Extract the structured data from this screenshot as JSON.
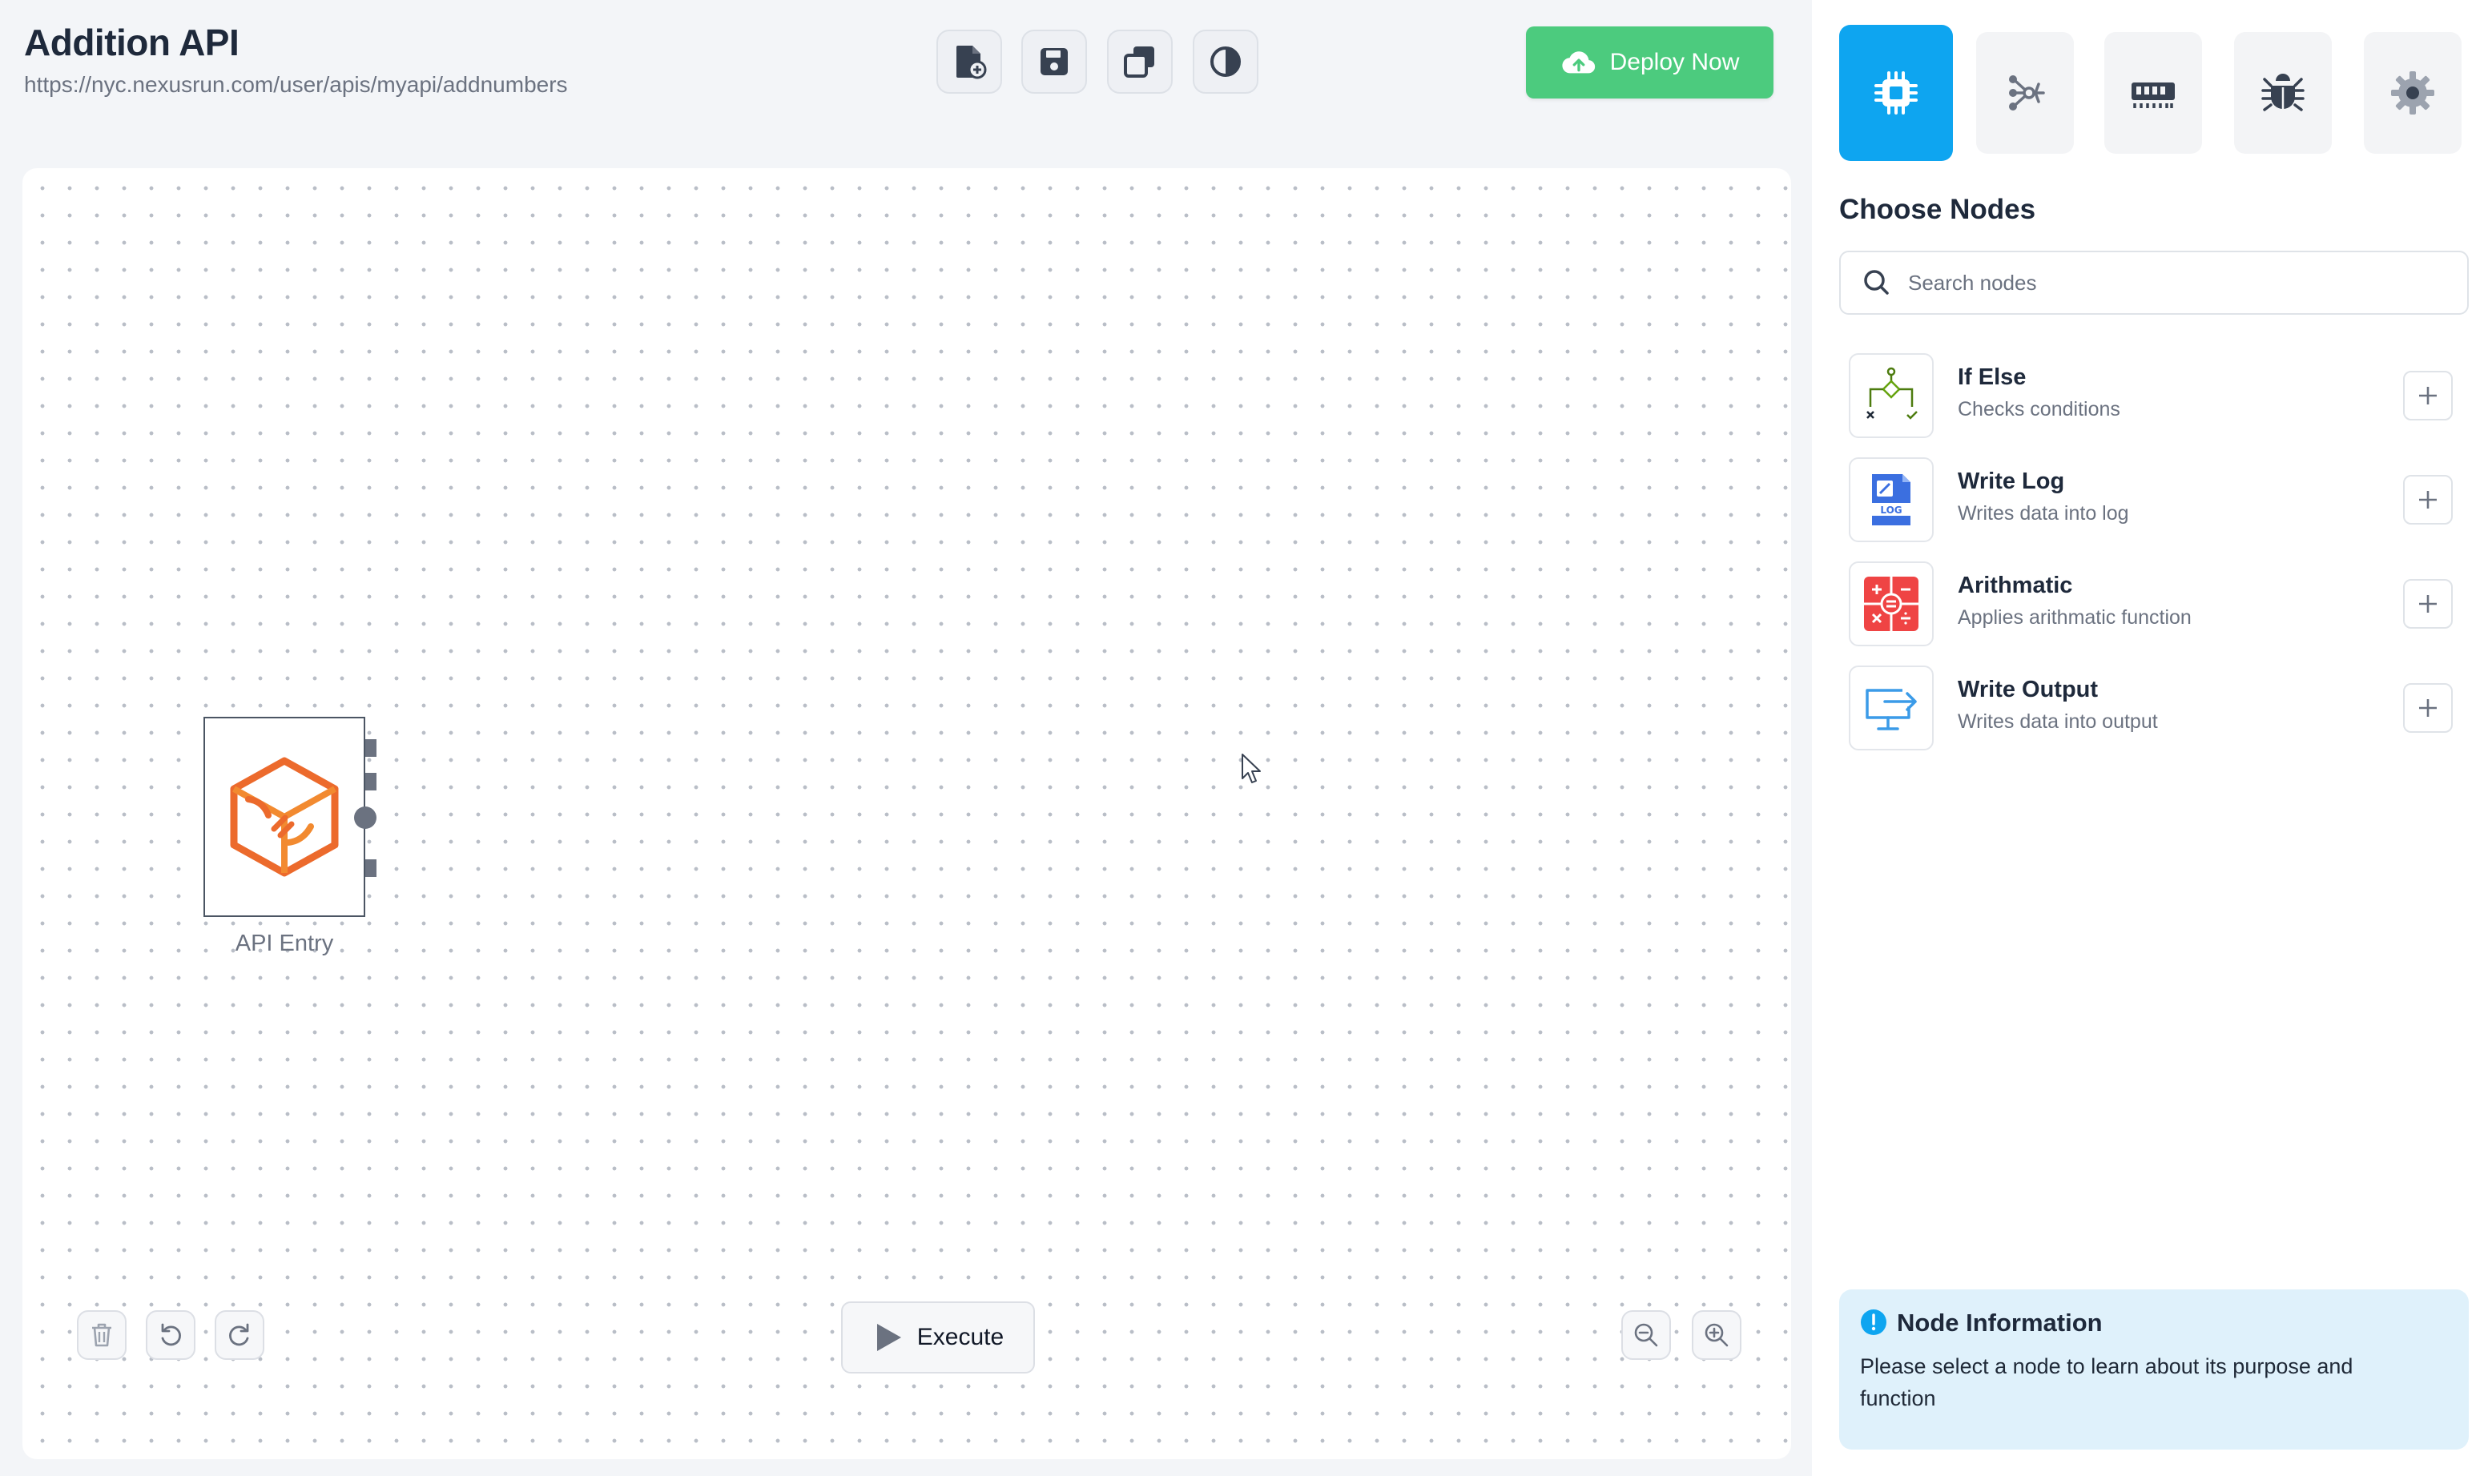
{
  "header": {
    "title": "Addition API",
    "url": "https://nyc.nexusrun.com/user/apis/myapi/addnumbers"
  },
  "toolbar": {
    "buttons": [
      {
        "icon": "new-file-icon"
      },
      {
        "icon": "save-icon"
      },
      {
        "icon": "duplicate-icon"
      },
      {
        "icon": "theme-contrast-icon"
      }
    ],
    "deploy_label": "Deploy Now",
    "deploy_color": "#4ccb7e"
  },
  "canvas": {
    "nodes": [
      {
        "label": "API Entry",
        "icon": "api-entry-icon",
        "color": "#ec6a2c"
      }
    ],
    "controls": {
      "left": [
        "trash-icon",
        "undo-icon",
        "redo-icon"
      ],
      "right": [
        "zoom-out-icon",
        "zoom-in-icon"
      ]
    },
    "execute_label": "Execute"
  },
  "panel": {
    "tabs": [
      {
        "icon": "chip-icon",
        "active": true
      },
      {
        "icon": "share-nodes-icon",
        "active": false
      },
      {
        "icon": "memory-icon",
        "active": false
      },
      {
        "icon": "bug-icon",
        "active": false
      },
      {
        "icon": "gear-icon",
        "active": false
      }
    ],
    "accent_color": "#0ea5f0",
    "title": "Choose Nodes",
    "search": {
      "placeholder": "Search nodes",
      "value": ""
    },
    "nodes": [
      {
        "name": "If Else",
        "description": "Checks conditions",
        "icon": "branch-icon"
      },
      {
        "name": "Write Log",
        "description": "Writes data into log",
        "icon": "log-icon"
      },
      {
        "name": "Arithmatic",
        "description": "Applies arithmatic function",
        "icon": "calculator-icon"
      },
      {
        "name": "Write Output",
        "description": "Writes data into output",
        "icon": "monitor-output-icon"
      }
    ],
    "info": {
      "title": "Node Information",
      "text": "Please select a node to learn about its purpose and function"
    }
  }
}
